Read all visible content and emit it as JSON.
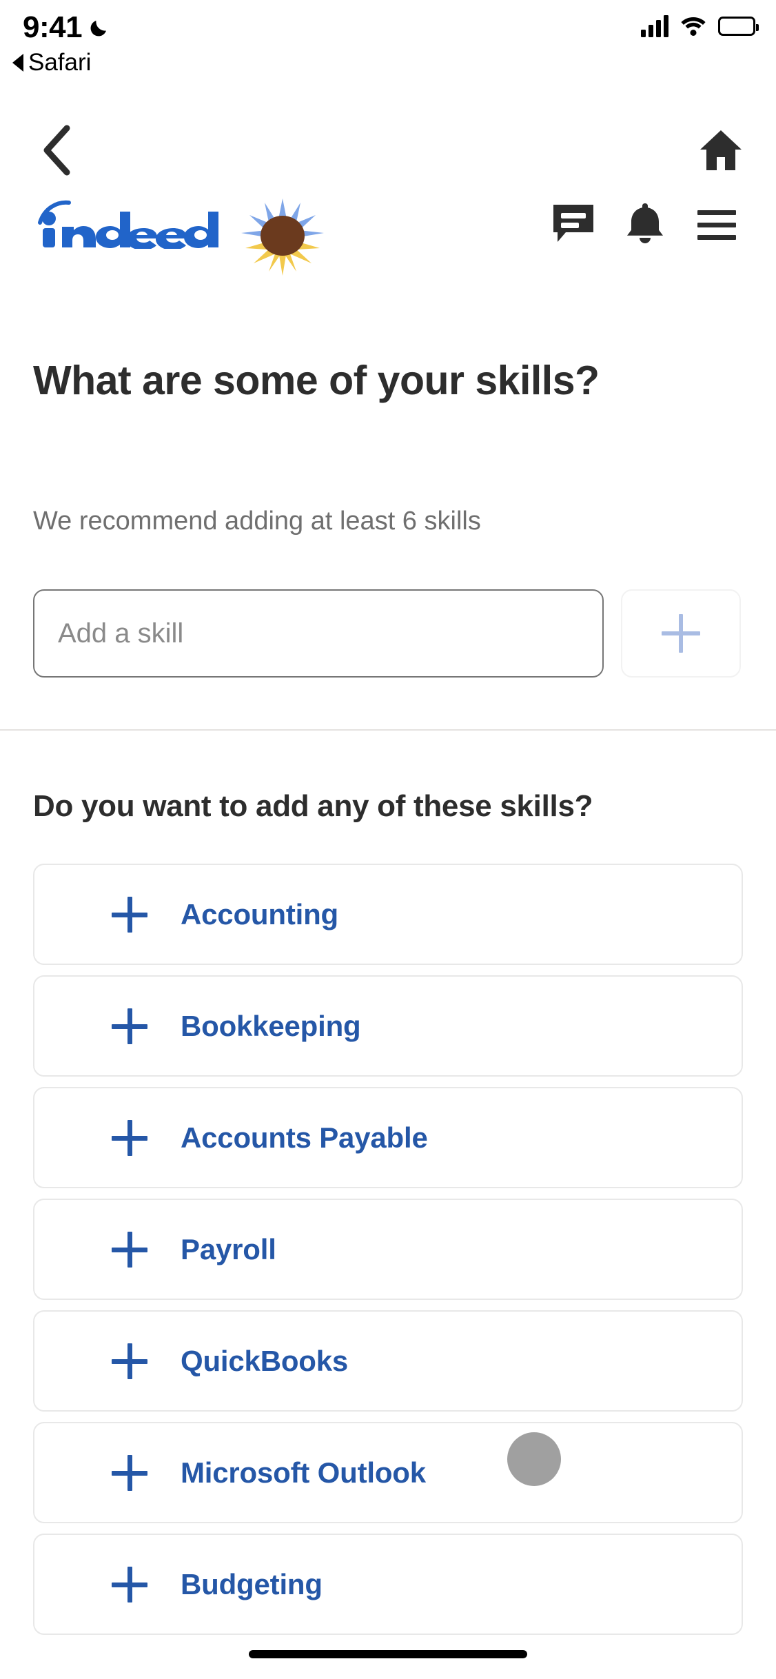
{
  "status_bar": {
    "time": "9:41",
    "dnd_icon": "moon-icon",
    "back_app_label": "Safari",
    "back_app_icon": "triangle-left-icon",
    "signal_icon": "cellular-signal-icon",
    "wifi_icon": "wifi-icon",
    "battery_icon": "battery-full-icon"
  },
  "nav": {
    "back_icon": "chevron-left-icon",
    "home_icon": "home-icon"
  },
  "brand": {
    "logo_text": "indeed",
    "logo_color": "#2164C9",
    "flower_icon": "sunflower-icon",
    "messages_icon": "message-bubble-icon",
    "notifications_icon": "bell-icon",
    "menu_icon": "hamburger-menu-icon"
  },
  "main": {
    "heading": "What are some of your skills?",
    "subheading": "We recommend adding at least 6 skills",
    "input_placeholder": "Add a skill",
    "input_value": "",
    "add_button_icon": "plus-icon"
  },
  "suggestions": {
    "title": "Do you want to add any of these skills?",
    "items": [
      {
        "label": "Accounting",
        "icon": "plus-icon"
      },
      {
        "label": "Bookkeeping",
        "icon": "plus-icon"
      },
      {
        "label": "Accounts Payable",
        "icon": "plus-icon"
      },
      {
        "label": "Payroll",
        "icon": "plus-icon"
      },
      {
        "label": "QuickBooks",
        "icon": "plus-icon"
      },
      {
        "label": "Microsoft Outlook",
        "icon": "plus-icon"
      },
      {
        "label": "Budgeting",
        "icon": "plus-icon"
      }
    ]
  },
  "colors": {
    "brand_blue": "#2557A7",
    "text_dark": "#2D2D2D",
    "text_muted": "#6F6F6F",
    "border": "#E8E8E8"
  },
  "overlay": {
    "touch_indicator": "tap-indicator"
  }
}
